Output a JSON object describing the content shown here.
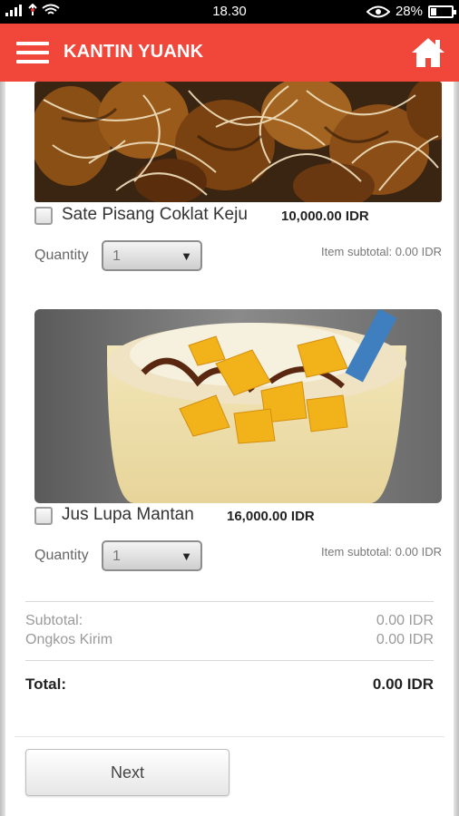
{
  "status_bar": {
    "time": "18.30",
    "battery": "28%",
    "battery_level": 0.28
  },
  "app_bar": {
    "title": "KANTIN YUANK",
    "menu_icon": "hamburger-menu-icon",
    "home_icon": "home-icon"
  },
  "colors": {
    "primary": "#f1463a",
    "status_bar": "#000000"
  },
  "items": [
    {
      "name": "Sate Pisang Coklat Keju",
      "price": "10,000.00 IDR",
      "quantity_label": "Quantity",
      "quantity": "1",
      "item_subtotal": "Item subtotal: 0.00 IDR"
    },
    {
      "name": "Jus Lupa Mantan",
      "price": "16,000.00 IDR",
      "quantity_label": "Quantity",
      "quantity": "1",
      "item_subtotal": "Item subtotal: 0.00 IDR"
    }
  ],
  "summary": {
    "subtotal_label": "Subtotal:",
    "subtotal_value": "0.00 IDR",
    "shipping_label": "Ongkos Kirim",
    "shipping_value": "0.00 IDR",
    "total_label": "Total:",
    "total_value": "0.00 IDR"
  },
  "next_button": "Next"
}
